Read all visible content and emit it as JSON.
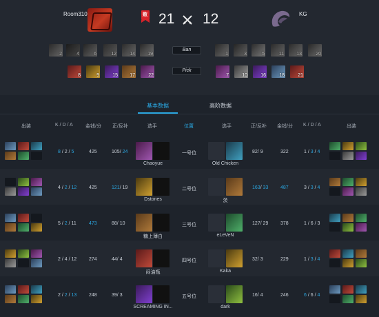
{
  "header": {
    "team_left": "Room310",
    "team_right": "KG",
    "score_left": "21",
    "score_right": "12",
    "flag_label": "败",
    "ban_label": "Ban",
    "pick_label": "Pick"
  },
  "bans_left": [
    "2",
    "4",
    "6",
    "12",
    "14",
    "19"
  ],
  "bans_right": [
    "1",
    "3",
    "5",
    "11",
    "13",
    "20"
  ],
  "picks_left": [
    "8",
    "9",
    "15",
    "17",
    "22"
  ],
  "picks_right": [
    "7",
    "10",
    "16",
    "18",
    "21"
  ],
  "tabs": [
    "基本数据",
    "高阶数据"
  ],
  "columns": {
    "items": "出装",
    "kda": "K / D / A",
    "gpm": "金钱/分",
    "lhdn": "正/反补",
    "player": "选手",
    "position": "位置"
  },
  "rows": [
    {
      "l_k": "8",
      "l_d": "2",
      "l_a": "5",
      "l_kda_hl": [
        true,
        false,
        true
      ],
      "l_gpm": "425",
      "l_gpm_hl": false,
      "l_lh": "105",
      "l_dn": "24",
      "l_lh_hl": false,
      "l_dn_hl": true,
      "l_player": "Chaoyue",
      "pos": "一号位",
      "r_player": "Old Chicken",
      "r_lh": "82",
      "r_dn": "9",
      "r_lh_hl": false,
      "r_dn_hl": false,
      "r_gpm": "322",
      "r_gpm_hl": false,
      "r_k": "1",
      "r_d": "3",
      "r_a": "4",
      "r_kda_hl": [
        false,
        true,
        true
      ]
    },
    {
      "l_k": "4",
      "l_d": "2",
      "l_a": "12",
      "l_kda_hl": [
        false,
        true,
        true
      ],
      "l_gpm": "425",
      "l_gpm_hl": false,
      "l_lh": "121",
      "l_dn": "19",
      "l_lh_hl": true,
      "l_dn_hl": false,
      "l_player": "Dstones",
      "pos": "二号位",
      "r_player": "茨",
      "r_lh": "163",
      "r_dn": "33",
      "r_lh_hl": true,
      "r_dn_hl": true,
      "r_gpm": "487",
      "r_gpm_hl": true,
      "r_k": "3",
      "r_d": "3",
      "r_a": "4",
      "r_kda_hl": [
        false,
        true,
        true
      ]
    },
    {
      "l_k": "5",
      "l_d": "2",
      "l_a": "11",
      "l_kda_hl": [
        false,
        true,
        false
      ],
      "l_gpm": "473",
      "l_gpm_hl": true,
      "l_lh": "88",
      "l_dn": "10",
      "l_lh_hl": false,
      "l_dn_hl": false,
      "l_player": "糖上薄白",
      "pos": "三号位",
      "r_player": "eLeVeN",
      "r_lh": "127",
      "r_dn": "29",
      "r_lh_hl": false,
      "r_dn_hl": false,
      "r_gpm": "378",
      "r_gpm_hl": false,
      "r_k": "1",
      "r_d": "6",
      "r_a": "3",
      "r_kda_hl": [
        false,
        false,
        false
      ]
    },
    {
      "l_k": "2",
      "l_d": "4",
      "l_a": "12",
      "l_kda_hl": [
        false,
        false,
        false
      ],
      "l_gpm": "274",
      "l_gpm_hl": false,
      "l_lh": "44",
      "l_dn": "4",
      "l_lh_hl": false,
      "l_dn_hl": false,
      "l_player": "闷油瓶",
      "pos": "四号位",
      "r_player": "Kaka",
      "r_lh": "32",
      "r_dn": "3",
      "r_lh_hl": false,
      "r_dn_hl": false,
      "r_gpm": "229",
      "r_gpm_hl": false,
      "r_k": "1",
      "r_d": "3",
      "r_a": "4",
      "r_kda_hl": [
        false,
        true,
        true
      ]
    },
    {
      "l_k": "2",
      "l_d": "2",
      "l_a": "13",
      "l_kda_hl": [
        false,
        true,
        true
      ],
      "l_gpm": "248",
      "l_gpm_hl": false,
      "l_lh": "39",
      "l_dn": "3",
      "l_lh_hl": false,
      "l_dn_hl": false,
      "l_player": "SCREAMING IN...",
      "pos": "五号位",
      "r_player": "dark",
      "r_lh": "16",
      "r_dn": "4",
      "r_lh_hl": false,
      "r_dn_hl": false,
      "r_gpm": "246",
      "r_gpm_hl": false,
      "r_k": "6",
      "r_d": "6",
      "r_a": "4",
      "r_kda_hl": [
        true,
        false,
        true
      ]
    }
  ],
  "colors": {
    "accent": "#2aa6e0",
    "background": "#1e232b",
    "header_bg": "#232830",
    "flag": "#d8232a"
  },
  "icons": {
    "team_left_logo": "dota2-logo",
    "team_right_logo": "kg-logo",
    "versus": "crossed-swords-icon"
  }
}
